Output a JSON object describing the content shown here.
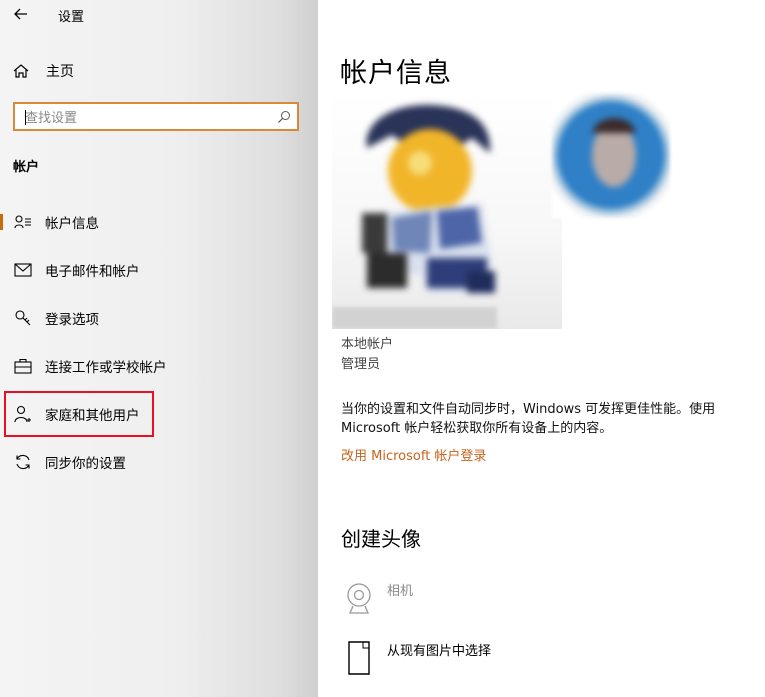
{
  "window": {
    "title": "设置"
  },
  "sidebar": {
    "home_label": "主页",
    "search": {
      "placeholder": "查找设置"
    },
    "section_label": "帐户",
    "items": [
      {
        "label": "帐户信息",
        "icon": "person-list-icon",
        "selected": true
      },
      {
        "label": "电子邮件和帐户",
        "icon": "mail-icon"
      },
      {
        "label": "登录选项",
        "icon": "key-icon"
      },
      {
        "label": "连接工作或学校帐户",
        "icon": "briefcase-icon"
      },
      {
        "label": "家庭和其他用户",
        "icon": "add-person-icon",
        "highlighted": true
      },
      {
        "label": "同步你的设置",
        "icon": "sync-icon"
      }
    ]
  },
  "main": {
    "title": "帐户信息",
    "account_type": "本地帐户",
    "account_role": "管理员",
    "description": "当你的设置和文件自动同步时，Windows 可发挥更佳性能。使用 Microsoft 帐户轻松获取你所有设备上的内容。",
    "ms_link": "改用 Microsoft 帐户登录",
    "create_avatar_title": "创建头像",
    "options": [
      {
        "label": "相机",
        "icon": "webcam-icon",
        "disabled": true
      },
      {
        "label": "从现有图片中选择",
        "icon": "file-icon"
      }
    ]
  },
  "colors": {
    "accent": "#c7631c",
    "highlight_border": "#e81123",
    "search_border": "#d8893a"
  }
}
